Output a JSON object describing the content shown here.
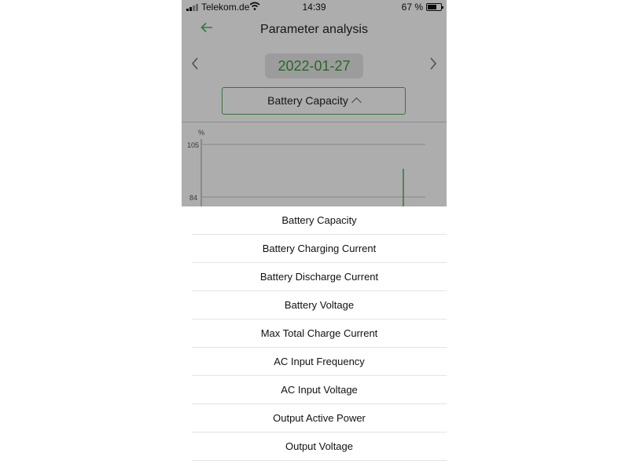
{
  "status_bar": {
    "carrier": "Telekom.de",
    "time": "14:39",
    "battery_percent": "67 %"
  },
  "header": {
    "title": "Parameter analysis",
    "back_icon": "arrow-left-icon"
  },
  "date_nav": {
    "date": "2022-01-27",
    "prev_icon": "chevron-left-icon",
    "next_icon": "chevron-right-icon"
  },
  "parameter_select": {
    "selected": "Battery Capacity",
    "icon": "chevron-up-icon"
  },
  "chart": {
    "unit": "%",
    "y_ticks": [
      "105",
      "84"
    ],
    "line_color": "#4caf50"
  },
  "picker": {
    "options": [
      "Battery Capacity",
      "Battery Charging Current",
      "Battery Discharge Current",
      "Battery Voltage",
      "Max Total Charge Current",
      "AC Input Frequency",
      "AC Input Voltage",
      "Output Active Power",
      "Output Voltage"
    ]
  },
  "colors": {
    "accent": "#4caf50",
    "date_text": "#3a9a3a"
  }
}
